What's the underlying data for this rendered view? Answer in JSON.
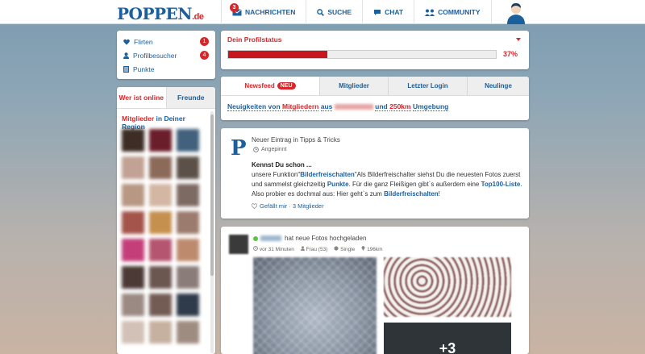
{
  "header": {
    "logo": "POPPEN",
    "logo_tld": ".de",
    "nav": [
      {
        "label": "NACHRICHTEN",
        "icon": "envelope-icon",
        "badge": "3"
      },
      {
        "label": "SUCHE",
        "icon": "search-icon"
      },
      {
        "label": "CHAT",
        "icon": "chat-icon"
      },
      {
        "label": "COMMUNITY",
        "icon": "users-icon"
      }
    ]
  },
  "sidebar": {
    "quick_links": [
      {
        "label": "Flirten",
        "icon": "heart-icon",
        "count": "1"
      },
      {
        "label": "Profilbesucher",
        "icon": "user-icon",
        "count": "4"
      },
      {
        "label": "Punkte",
        "icon": "list-icon"
      }
    ],
    "online_tabs": [
      "Wer ist online",
      "Freunde"
    ],
    "region_prefix": "Mitglieder",
    "region_link": "in Deiner Region"
  },
  "profile_status": {
    "title": "Dein Profilstatus",
    "percent_label": "37%",
    "progress": 0.37
  },
  "feed": {
    "tabs": [
      "Newsfeed",
      "Mitglieder",
      "Letzter Login",
      "Neulinge"
    ],
    "new_badge": "NEU",
    "filter": {
      "w1": "Neuigkeiten von",
      "w2": "Mitgliedern",
      "w3": "aus",
      "w4": "und",
      "w5": "250km",
      "w6": "Umgebung"
    }
  },
  "post1": {
    "logo_letter": "P",
    "title": "Neuer Eintrag in Tipps & Tricks",
    "pinned": "Angepinnt",
    "heading": "Kennst Du schon ...",
    "t1": "unsere Funktion\"",
    "l1": "Bilderfreischalten",
    "t2": "\"Als Bilderfreischalter siehst Du die neuesten Fotos zuerst und sammelst gleichzeitig",
    "l2": "Punkte",
    "t3": ". Für die ganz Fleißigen gibt`s außerdem eine",
    "l3": "Top100-Liste",
    "t4": ". Also probier es dochmal aus: Hier geht`s zum",
    "l4": "Bilderfreischalten",
    "t5": "!",
    "like_text": "Gefällt mir · 3 Mitglieder"
  },
  "post2": {
    "action": "hat neue Fotos hochgeladen",
    "time": "vor 31 Minuten",
    "gender": "Frau (53)",
    "status": "Single",
    "distance": "196km",
    "more_count": "+3"
  },
  "colors": {
    "brand_blue": "#1b5f9c",
    "accent_red": "#d7262a"
  }
}
